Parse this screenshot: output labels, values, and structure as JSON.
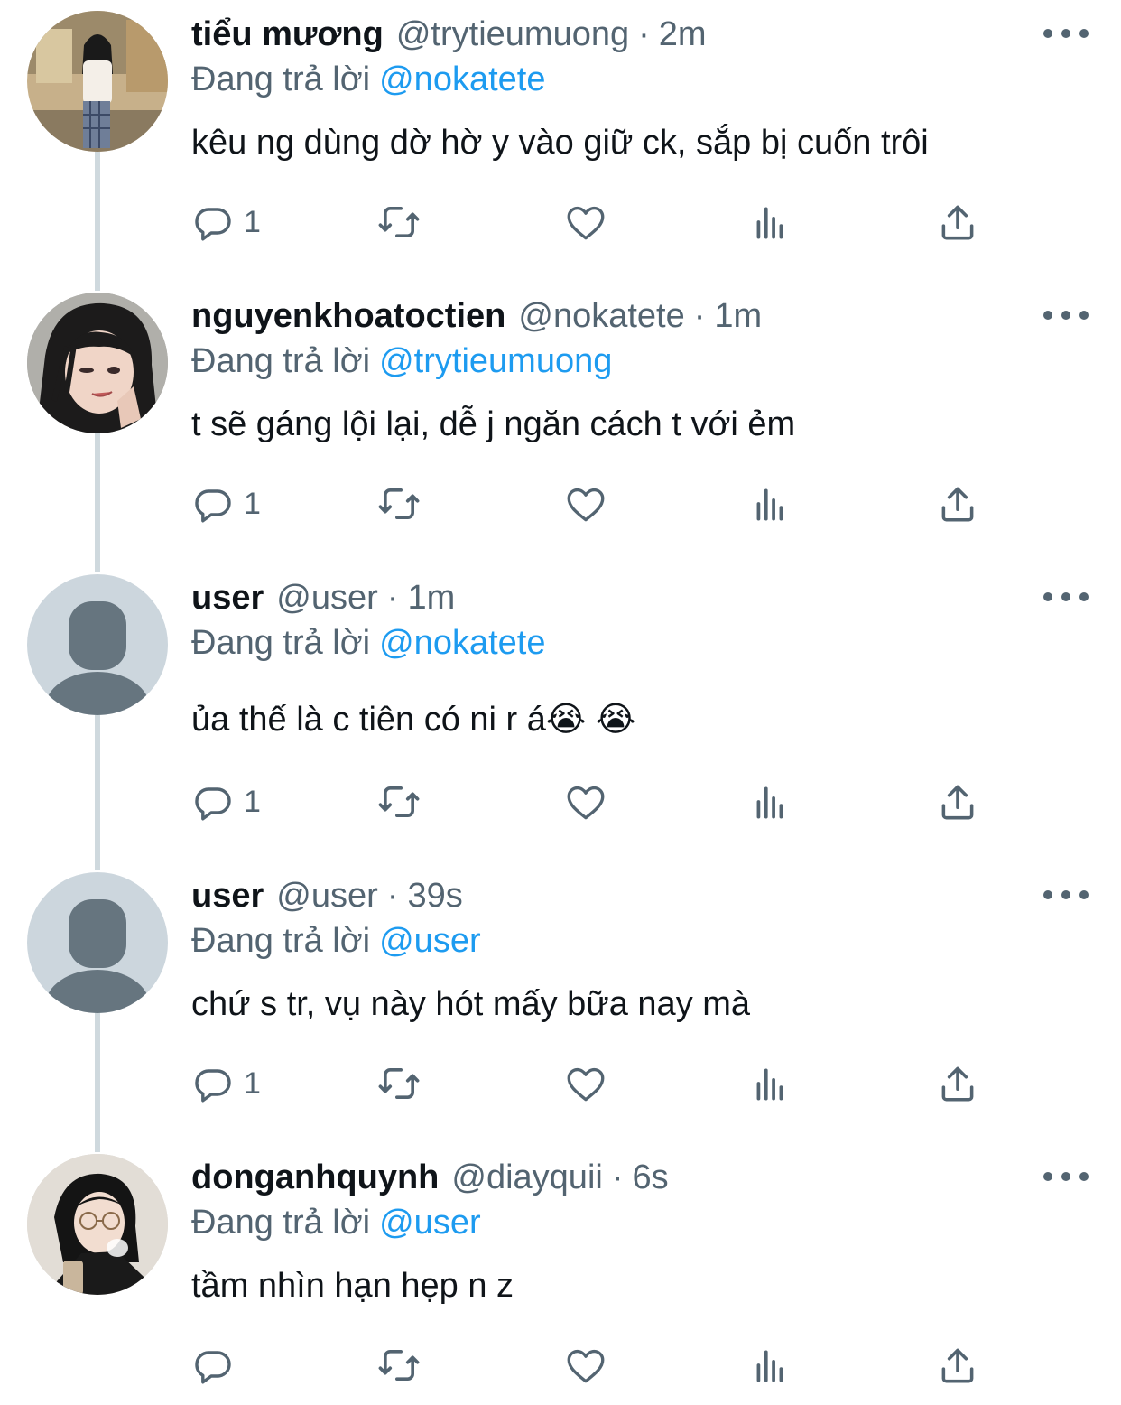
{
  "theme": {
    "text_color": "#0f1419",
    "secondary_color": "#536471",
    "mention_color": "#1d9bf0",
    "thread_line_color": "#cfd9de",
    "default_avatar_bg": "#ccd6dd",
    "default_avatar_fg": "#66757f"
  },
  "tweets": [
    {
      "name": "tiểu mương",
      "handle": "@trytieumuong",
      "separator": "·",
      "time": "2m",
      "reply_prefix": "Đang trả lời",
      "reply_to": "@nokatete",
      "text": "kêu ng dùng dờ hờ y vào giữ ck, sắp bị cuốn trôi",
      "reply_count": "1",
      "avatar": "photo-avatar"
    },
    {
      "name": "nguyenkhoatoctien",
      "handle": "@nokatete",
      "separator": "·",
      "time": "1m",
      "reply_prefix": "Đang trả lời",
      "reply_to": "@trytieumuong",
      "text": "t sẽ gáng lội lại, dễ j ngăn cách t với ẻm",
      "reply_count": "1",
      "avatar": "photo-avatar"
    },
    {
      "name": "user",
      "handle": "@user",
      "separator": "·",
      "time": "1m",
      "reply_prefix": "Đang trả lời",
      "reply_to": "@nokatete",
      "text": "ủa thế là c tiên có ni r á😭 😭",
      "reply_count": "1",
      "avatar": "default-avatar"
    },
    {
      "name": "user",
      "handle": "@user",
      "separator": "·",
      "time": "39s",
      "reply_prefix": "Đang trả lời",
      "reply_to": "@user",
      "text": "chứ s tr, vụ này hót mấy bữa nay mà",
      "reply_count": "1",
      "avatar": "default-avatar"
    },
    {
      "name": "donganhquynh",
      "handle": "@diayquii",
      "separator": "·",
      "time": "6s",
      "reply_prefix": "Đang trả lời",
      "reply_to": "@user",
      "text": "tầm nhìn hạn hẹp n z",
      "reply_count": "",
      "avatar": "photo-avatar"
    }
  ],
  "icons": {
    "reply": "reply-icon",
    "retweet": "retweet-icon",
    "like": "like-icon",
    "views": "views-icon",
    "share": "share-icon",
    "more": "more-options-icon"
  }
}
